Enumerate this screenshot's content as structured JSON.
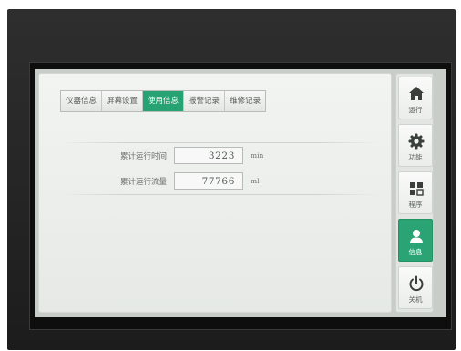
{
  "tabs": [
    {
      "label": "仪器信息",
      "active": false
    },
    {
      "label": "屏幕设置",
      "active": false
    },
    {
      "label": "使用信息",
      "active": true
    },
    {
      "label": "报警记录",
      "active": false
    },
    {
      "label": "维修记录",
      "active": false
    }
  ],
  "info": {
    "runtime": {
      "label": "累计运行时间",
      "value": "3223",
      "unit": "min"
    },
    "flow": {
      "label": "累计运行流量",
      "value": "77766",
      "unit": "ml"
    }
  },
  "nav": [
    {
      "label": "运行",
      "icon": "home-icon",
      "active": false
    },
    {
      "label": "功能",
      "icon": "gear-icon",
      "active": false
    },
    {
      "label": "程序",
      "icon": "grid-icon",
      "active": false
    },
    {
      "label": "信息",
      "icon": "user-icon",
      "active": true
    },
    {
      "label": "关机",
      "icon": "power-icon",
      "active": false
    }
  ],
  "colors": {
    "accent": "#27a272",
    "bezel": "#0e0e0e",
    "panel": "#eef0ee"
  }
}
